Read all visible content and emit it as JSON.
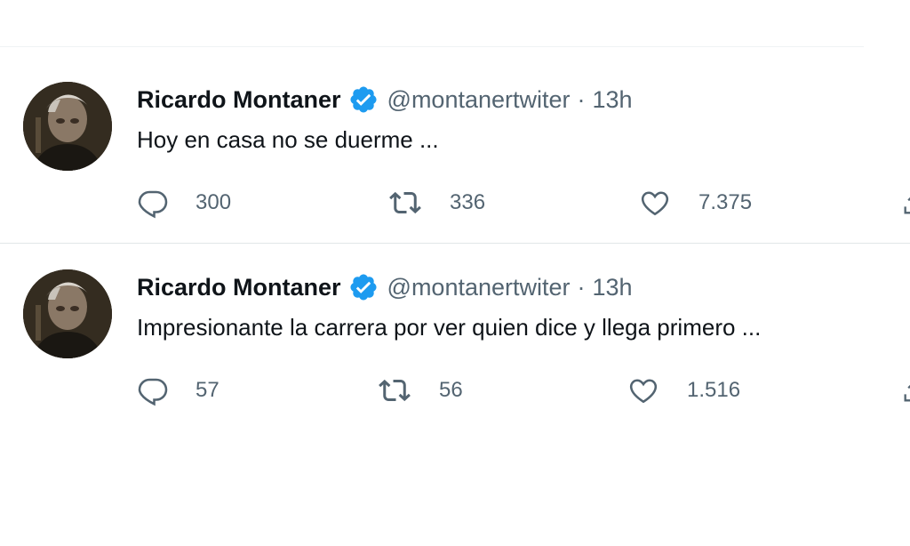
{
  "colors": {
    "verified": "#1d9bf0",
    "text_primary": "#0f1419",
    "text_secondary": "#536471",
    "divider": "#eff3f4"
  },
  "tweets": [
    {
      "name": "Ricardo Montaner",
      "handle": "@montanertwiter",
      "separator": "·",
      "time": "13h",
      "text": "Hoy en casa no se duerme ...",
      "replies": "300",
      "retweets": "336",
      "likes": "7.375",
      "icons": [
        "reply-icon",
        "retweet-icon",
        "like-icon",
        "share-icon"
      ]
    },
    {
      "name": "Ricardo Montaner",
      "handle": "@montanertwiter",
      "separator": "·",
      "time": "13h",
      "text": "Impresionante la carrera por ver quien dice y llega primero ...",
      "replies": "57",
      "retweets": "56",
      "likes": "1.516",
      "icons": [
        "reply-icon",
        "retweet-icon",
        "like-icon",
        "share-icon"
      ]
    }
  ]
}
